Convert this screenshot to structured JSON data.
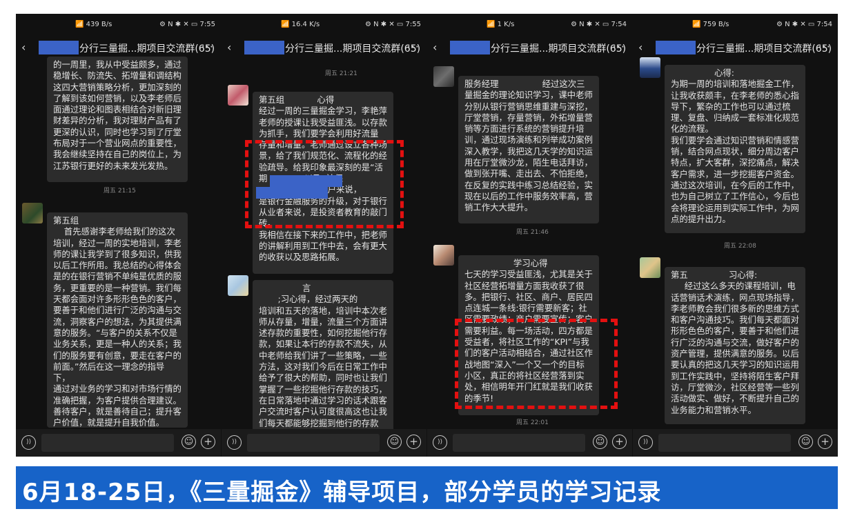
{
  "group_title": "分行三量掘...期项目交流群(65)",
  "back_icon": "‹",
  "more_icon": "···",
  "panels": [
    {
      "status_left": "📶 439 B/s",
      "status_right": "⚙ N ✱ ✕ ▭ 7:55",
      "messages": [
        "的一周里，我从中受益颇多，通过\n稳增长、防流失、拓增量和调结构\n这四大营销策略分析，更加深刻的\n了解到该如何营销，以及李老师后\n面通过理论和图表相结合对新旧理\n财差异的分析，我对理财产品有了\n更深的认识，同时也学习到了厅堂\n布局对于一个营业网点的重要性，\n我会继续坚持在自己的岗位上，为\n江苏银行更好的未来发光发热。",
        "第五组\n    首先感谢李老师给我们的这次\n培训，经过一周的实地培训，李老\n师的课让我学到了很多知识，供我\n以后工作所用。我总结的心得体会\n是的在银行营销不单纯是优质的服\n务，更重要的是一种营销。我们每\n天都会面对许多形形色色的客户，\n要善于和他们进行广泛的沟通与交\n流，洞察客户的想法，为其提供满\n意的服务。“与客户的关系不仅是\n业务关系，更是一种人的关系；我\n们的服务要有创意，要走在客户的\n前面。”然后在这一理念的指导下，\n通过对业务的学习和对市场行情的\n准确把握，为客户提供合理建议。\n善待客户，就是善待自己；提升客\n户价值，就是提升自我价值。"
      ],
      "times": [
        "周五 21:15"
      ]
    },
    {
      "status_left": "📶 16.4 K/s",
      "status_right": "⚙ N ✱ ✕ ▭ 7:55",
      "messages": [
        "第五组            心得\n经过一周的三量掘金学习，李艳萍\n老师的授课让我受益匪浅。以存款\n为抓手，我们要学会利用好流量\n存量和增量。老师通过设立各种场\n景，给了我们规范化、流程化的经\n验疏导。给我印象最深刻的是“活\n期            ”以及“社保\n                   于客户来说，\n是银行金融服务的升级，对于银行\n从业者来说，是投资者教育的敲门\n砖。\n我相信在接下来的工作中，把老师\n的讲解利用到工作中去，会有更大\n的收获以及思路拓展。",
        "                言\n       ;习心得，经过两天的\n培训和五天的落地，培训中本次老\n师从存量，增量，流量三个方面讲\n述存款的重要性，如何挖掘他行存\n款，如果让本行的存款不流失，从\n中老师给我们讲了一些策略，一些\n方法，这对我们今后在日常工作中\n给予了很大的帮助，同时也让我们\n掌握了一些挖掘他行存款的技巧，\n在日常落地中通过学习的话术跟客\n户交流时客户认可度很高这也让我\n们每天都能够挖掘到他行的存款"
      ],
      "times": [
        "周五 21:21"
      ]
    },
    {
      "status_left": "📶 1 K/s",
      "status_right": "⚙ N ✱ ✕ ▭ 7:54",
      "messages": [
        "服务经理                经过这次三\n量掘金的理论知识学习，课中老师\n分别从银行营销思维重建与深挖，\n厅堂营销，存量营销，外拓增量营\n销等方面进行系统的营销提升培\n训，通过现场演练和列举成功案例\n深入教学，我把这几天学的知识运\n用在厅堂微沙龙，陌生电话拜访，\n做到张开嘴、走出去、不怕拒绝，\n在反复的实践中练习总结经验，实\n现在以后的工作中服务效率高，营\n销工作大大提升。",
        "                  学习心得\n七天的学习受益匪浅，尤其是关于\n社区经营拓增量方面我收获了很\n多。把银行、社区、商户、居民四\n点连城一条线:银行需要新客；社\n区需要政绩；商户需要宣传；客户\n需要利益。每一场活动，四方都是\n受益者，将社区工作的“KPI”与我\n们的客户活动相结合，通过社区作\n战地图“深入”一个又一个的目标\n小区，真正的将社区经营落到实\n处，相信明年开门红就是我们收获\n的季节!"
      ],
      "times": [
        "周五 21:46",
        "周五 22:01"
      ]
    },
    {
      "status_left": "📶 759 B/s",
      "status_right": "⚙ N ✱ ✕ ▭ 7:54",
      "messages": [
        "                心得:\n为期一周的培训和落地掘金工作，\n让我收获颇丰，在李老师的悉心指\n导下，繁杂的工作也可以通过梳\n理、复盘、归纳成一套标准化规范\n化的流程。\n我们要学会通过知识营销和情感营\n销，结合网点现状，细分周边客户\n特点，扩大客群，深挖痛点，解决\n客户需求，进一步挖掘客户资金。\n通过这次培训，在今后的工作中，\n也为自己树立了工作信心，今后也\n会将理论运用到实际工作中，为网\n点的提升出力。",
        "第五               习心得:\n     经过这么多天的课程培训，电\n话营销话术演练，网点现场指导，\n李老师教会我们很多新的思维方式\n和客户沟通技巧。我们每天都面对\n形形色色的客户，要善于和他们进\n行广泛的沟通与交流，做好客户的\n资产管理，提供满意的服务。以后\n要认真的把这几天学习的知识运用\n到工作实践中，坚持将陌生客户拜\n访，厅堂微沙，社区经营等一些列\n活动做实、做好，不断提升自己的\n业务能力和营销水平。"
      ],
      "times": [
        "周五 22:08"
      ]
    }
  ],
  "input_icons": {
    "voice": "))",
    "emoji": "☺",
    "plus": "+"
  },
  "caption": "6月18-25日，《三量掘金》辅导项目，部分学员的学习记录"
}
